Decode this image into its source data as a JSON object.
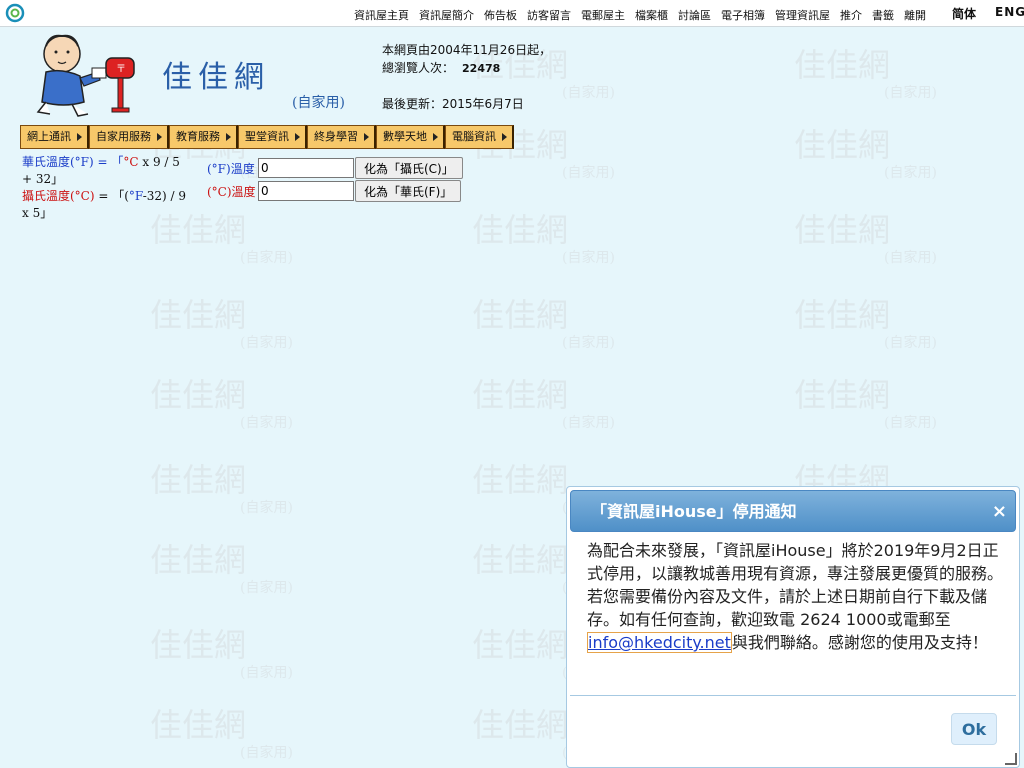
{
  "top_nav": {
    "links": [
      "資訊屋主頁",
      "資訊屋簡介",
      "佈告板",
      "訪客留言",
      "電郵屋主",
      "檔案櫃",
      "討論區",
      "電子相簿",
      "管理資訊屋",
      "推介",
      "書籤",
      "離開"
    ],
    "lang_sc": "简体",
    "lang_en": "ENG"
  },
  "header": {
    "logo_text": "佳佳網",
    "logo_sub": "(自家用)",
    "since": "本網頁由2004年11月26日起，",
    "visits_label": "總瀏覽人次：",
    "visits_count": "22478",
    "updated": "最後更新：2015年6月7日"
  },
  "menu": {
    "items": [
      "網上通訊",
      "自家用服務",
      "教育服務",
      "聖堂資訊",
      "終身學習",
      "數學天地",
      "電腦資訊"
    ]
  },
  "converter": {
    "f_formula_a": "華氏溫度(°F) = 「",
    "f_formula_b": "°C",
    "f_formula_c": " x 9 / 5 + 32」",
    "c_formula_a": "攝氏溫度(°C)",
    "c_formula_b": " = 「(",
    "c_formula_c": "°F",
    "c_formula_d": "-32) / 9 x 5」",
    "f_label_unit": "(°F)",
    "f_label_text": "溫度",
    "c_label_unit": "(°C)",
    "c_label_text": "溫度",
    "f_value": "0",
    "c_value": "0",
    "to_c_button": "化為「攝氏(C)」",
    "to_f_button": "化為「華氏(F)」"
  },
  "dialog": {
    "title": "「資訊屋iHouse」停用通知",
    "close": "×",
    "body_before": "為配合未來發展，「資訊屋iHouse」將於2019年9月2日正式停用，以讓教城善用現有資源，專注發展更優質的服務。若您需要備份內容及文件，請於上述日期前自行下載及儲存。如有任何查詢，歡迎致電 2624 1000或電郵至",
    "email": "info@hkedcity.net",
    "body_after": "與我們聯絡。感謝您的使用及支持！",
    "ok_label": "Ok"
  },
  "watermark": {
    "text": "佳佳網",
    "sub": "(自家用)"
  }
}
